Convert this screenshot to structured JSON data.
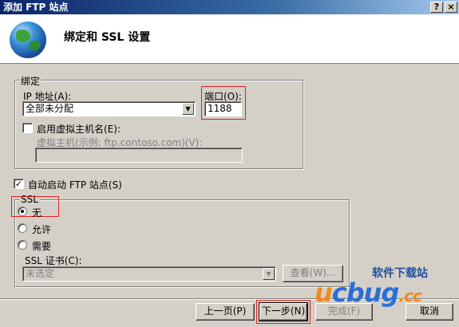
{
  "window": {
    "title": "添加 FTP 站点",
    "help_label": "?",
    "close_label": "×"
  },
  "header": {
    "icon": "globe-icon",
    "title": "绑定和 SSL 设置"
  },
  "binding": {
    "group_label": "绑定",
    "ip_label": "IP 地址(A):",
    "ip_value": "全部未分配",
    "port_label": "端口(O):",
    "port_value": "1188",
    "virtual_host_checkbox_label": "启用虚拟主机名(E):",
    "virtual_host_checked": false,
    "virtual_host_hint": "虚拟主机(示例: ftp.contoso.com)(V):",
    "virtual_host_value": ""
  },
  "autostart": {
    "label": "自动启动 FTP 站点(S)",
    "checked": true
  },
  "ssl": {
    "group_label": "SSL",
    "options": [
      {
        "label": "无",
        "checked": true
      },
      {
        "label": "允许",
        "checked": false
      },
      {
        "label": "需要",
        "checked": false
      }
    ],
    "cert_label": "SSL 证书(C):",
    "cert_value": "未选定",
    "view_button": "查看(W)..."
  },
  "footer": {
    "prev": "上一页(P)",
    "next": "下一步(N)",
    "finish": "完成(F)",
    "cancel": "取消"
  },
  "watermark": {
    "logo_u": "u",
    "logo_rest": "cbug",
    "logo_tld": ".cc",
    "site": "软件下载站"
  },
  "colors": {
    "highlight": "#e02020",
    "titlebar": "#0a246a"
  }
}
